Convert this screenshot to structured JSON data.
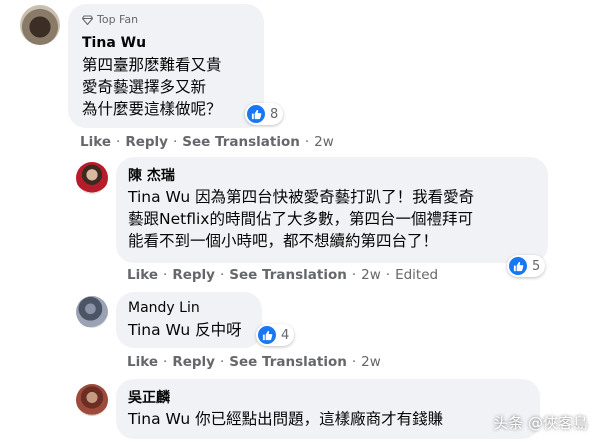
{
  "comments": [
    {
      "badge": "Top Fan",
      "author": "Tina Wu",
      "lines": [
        "第四臺那麽難看又貴",
        "愛奇藝選擇多又新",
        "為什麼要這樣做呢？"
      ],
      "reactions": "8",
      "actions": {
        "like": "Like",
        "reply": "Reply",
        "translate": "See Translation",
        "time": "2w"
      }
    },
    {
      "author": "陳 杰瑞",
      "mention": "Tina Wu",
      "lines": [
        " 因為第四台快被愛奇藝打趴了！我看愛奇",
        "藝跟Netflix的時間佔了大多數，第四台一個禮拜可",
        "能看不到一個小時吧，都不想續約第四台了！"
      ],
      "reactions": "5",
      "actions": {
        "like": "Like",
        "reply": "Reply",
        "translate": "See Translation",
        "time": "2w",
        "edited": "Edited"
      }
    },
    {
      "author": "Mandy Lin",
      "mention": "Tina Wu",
      "text": " 反中呀",
      "reactions": "4",
      "actions": {
        "like": "Like",
        "reply": "Reply",
        "translate": "See Translation",
        "time": "2w"
      }
    },
    {
      "author": "吳正麟",
      "mention": "Tina Wu",
      "text": " 你已經點出問題，這樣廠商才有錢賺"
    }
  ],
  "watermark": "头条 @俠客島",
  "colors": {
    "bubble": "#f0f2f5",
    "like_blue": "#1877f2",
    "meta_gray": "#65676b"
  }
}
